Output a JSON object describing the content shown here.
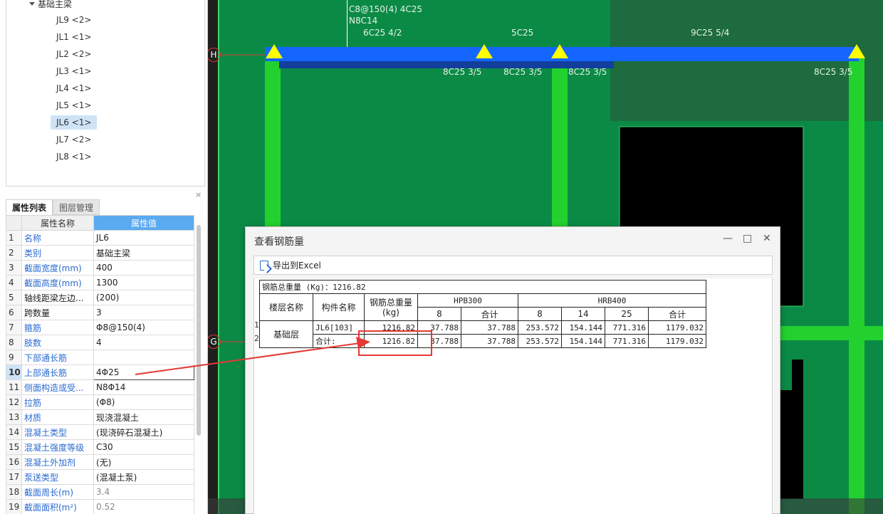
{
  "tree": {
    "parent_label": "基础主梁",
    "items": [
      {
        "label": "JL9 <2>"
      },
      {
        "label": "JL1 <1>"
      },
      {
        "label": "JL2 <2>"
      },
      {
        "label": "JL3 <1>"
      },
      {
        "label": "JL4 <1>"
      },
      {
        "label": "JL5 <1>"
      },
      {
        "label": "JL6 <1>",
        "selected": true
      },
      {
        "label": "JL7 <2>"
      },
      {
        "label": "JL8 <1>"
      }
    ]
  },
  "panel": {
    "close_label": "×",
    "tabs": [
      "属性列表",
      "图层管理"
    ],
    "header_name": "属性名称",
    "header_value": "属性值",
    "rows": [
      {
        "no": "1",
        "name": "名称",
        "value": "JL6",
        "style": "blue"
      },
      {
        "no": "2",
        "name": "类别",
        "value": "基础主梁",
        "style": "blue"
      },
      {
        "no": "3",
        "name": "截面宽度(mm)",
        "value": "400",
        "style": "blue"
      },
      {
        "no": "4",
        "name": "截面高度(mm)",
        "value": "1300",
        "style": "blue"
      },
      {
        "no": "5",
        "name": "轴线距梁左边...",
        "value": "(200)",
        "style": "black"
      },
      {
        "no": "6",
        "name": "跨数量",
        "value": "3",
        "style": "black"
      },
      {
        "no": "7",
        "name": "箍筋",
        "value": "Φ8@150(4)",
        "style": "blue"
      },
      {
        "no": "8",
        "name": "肢数",
        "value": "4",
        "style": "blue"
      },
      {
        "no": "9",
        "name": "下部通长筋",
        "value": "",
        "style": "blue"
      },
      {
        "no": "10",
        "name": "上部通长筋",
        "value": "4Φ25",
        "style": "blue",
        "selected": true
      },
      {
        "no": "11",
        "name": "侧面构造或受...",
        "value": "N8Φ14",
        "style": "blue"
      },
      {
        "no": "12",
        "name": "拉筋",
        "value": "(Φ8)",
        "style": "blue"
      },
      {
        "no": "13",
        "name": "材质",
        "value": "现浇混凝土",
        "style": "blue"
      },
      {
        "no": "14",
        "name": "混凝土类型",
        "value": "(现浇碎石混凝土)",
        "style": "blue"
      },
      {
        "no": "15",
        "name": "混凝土强度等级",
        "value": "C30",
        "style": "blue"
      },
      {
        "no": "16",
        "name": "混凝土外加剂",
        "value": "(无)",
        "style": "blue"
      },
      {
        "no": "17",
        "name": "泵送类型",
        "value": "(混凝土泵)",
        "style": "blue"
      },
      {
        "no": "18",
        "name": "截面周长(m)",
        "value": "3.4",
        "style": "blue",
        "value_gray": true
      },
      {
        "no": "19",
        "name": "截面面积(m²)",
        "value": "0.52",
        "style": "blue",
        "value_gray": true
      }
    ]
  },
  "canvas": {
    "labels": [
      "C8@150(4) 4C25",
      "N8C14",
      "6C25 4/2",
      "5C25",
      "9C25 5/4",
      "8C25 3/5",
      "8C25 3/5",
      "8C25 3/5",
      "8C25 3/5"
    ],
    "axis_labels": [
      "H",
      "G"
    ]
  },
  "dialog": {
    "title": "查看钢筋量",
    "minimize": "—",
    "maximize": "□",
    "close": "✕",
    "export_label": "导出到Excel",
    "table": {
      "total_line": "钢筋总重量 (Kg)：1216.82",
      "col_floor": "楼层名称",
      "col_member": "构件名称",
      "col_total": "钢筋总重量(kg)",
      "grade1": "HPB300",
      "grade2": "HRB400",
      "sub_headers": [
        "8",
        "合计",
        "8",
        "14",
        "25",
        "合计"
      ],
      "floor_name": "基础层",
      "row_numbers": [
        "1",
        "2"
      ],
      "rows": [
        {
          "member": "JL6[103]",
          "total": "1216.82",
          "values": [
            "37.788",
            "37.788",
            "253.572",
            "154.144",
            "771.316",
            "1179.032"
          ]
        },
        {
          "member": "合计:",
          "total": "1216.82",
          "values": [
            "37.788",
            "37.788",
            "253.572",
            "154.144",
            "771.316",
            "1179.032"
          ]
        }
      ]
    }
  }
}
